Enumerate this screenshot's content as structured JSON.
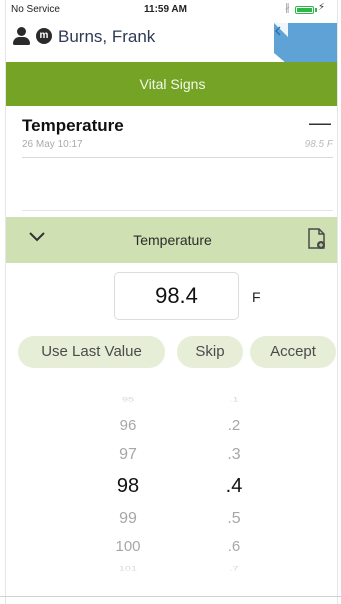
{
  "status_bar": {
    "carrier": "No Service",
    "time": "11:59 AM",
    "bluetooth": "∦",
    "charging": "⚡"
  },
  "patient": {
    "badge": "m",
    "name": "Burns, Frank"
  },
  "header": {
    "title": "Vital Signs"
  },
  "vital_row": {
    "label": "Temperature",
    "action": "—",
    "date": "26 May 10:17",
    "value": "98.5 F"
  },
  "editor": {
    "title": "Temperature",
    "value": "98.4",
    "unit": "F"
  },
  "buttons": {
    "use_last_value": "Use Last Value",
    "skip": "Skip",
    "accept": "Accept"
  },
  "picker": {
    "integer_items": [
      "95",
      "96",
      "97",
      "98",
      "99",
      "100",
      "101"
    ],
    "decimal_items": [
      ".1",
      ".2",
      ".3",
      ".4",
      ".5",
      ".6",
      ".7"
    ],
    "selected_integer": "98",
    "selected_decimal": ".4"
  },
  "icons": {
    "person": "person-icon",
    "chevron": "chevron-down-icon",
    "document": "document-add-icon",
    "flag": "flag-tab-icon"
  },
  "colors": {
    "header_green": "#74a326",
    "editor_green": "#cfe0b2",
    "button_green": "#e6eed7",
    "tab_blue": "#5ea2d6"
  }
}
